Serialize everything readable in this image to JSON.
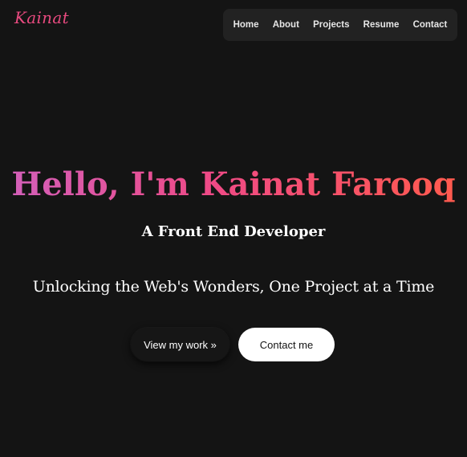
{
  "logo": {
    "text": "Kainat"
  },
  "nav": {
    "items": [
      "Home",
      "About",
      "Projects",
      "Resume",
      "Contact"
    ]
  },
  "hero": {
    "title": "Hello, I'm Kainat Farooq",
    "subtitle": "A Front End Developer",
    "tagline": "Unlocking the Web's Wonders, One Project at a Time"
  },
  "buttons": {
    "view_work": "View my work »",
    "contact": "Contact me"
  },
  "colors": {
    "background": "#141414",
    "nav_background": "#222222",
    "logo": "#e84a7f",
    "gradient_start": "#d35fb8",
    "gradient_mid": "#ef4a86",
    "gradient_end": "#ff5a4e"
  }
}
